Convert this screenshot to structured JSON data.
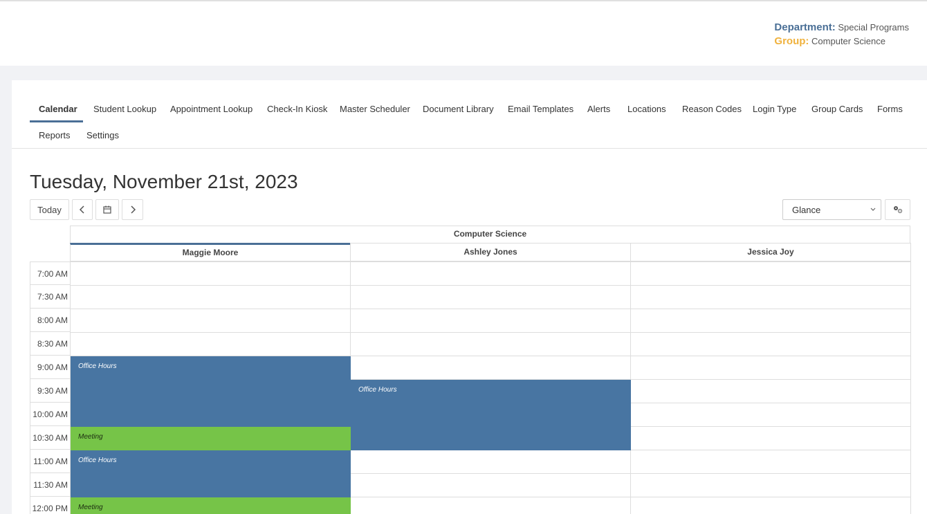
{
  "header": {
    "department_label": "Department:",
    "department_value": "Special Programs",
    "group_label": "Group:",
    "group_value": "Computer Science"
  },
  "nav": {
    "items": [
      {
        "label": "Calendar",
        "active": true
      },
      {
        "label": "Student Lookup"
      },
      {
        "label": "Appointment Lookup"
      },
      {
        "label": "Check-In Kiosk"
      },
      {
        "label": "Master Scheduler"
      },
      {
        "label": "Document Library"
      },
      {
        "label": "Email Templates"
      },
      {
        "label": "Alerts"
      },
      {
        "label": "Locations"
      },
      {
        "label": "Reason Codes"
      },
      {
        "label": "Login Type"
      },
      {
        "label": "Group Cards"
      },
      {
        "label": "Forms"
      },
      {
        "label": "Reports"
      },
      {
        "label": "Settings"
      }
    ]
  },
  "calendar": {
    "date_title": "Tuesday, November 21st, 2023",
    "today_label": "Today",
    "prev_icon": "chevron-left-icon",
    "calendar_icon": "calendar-icon",
    "next_icon": "chevron-right-icon",
    "view_select": "Glance",
    "settings_icon": "gears-icon",
    "group_name": "Computer Science",
    "staff": [
      "Maggie Moore",
      "Ashley Jones",
      "Jessica Joy"
    ],
    "times": [
      "7:00 AM",
      "7:30 AM",
      "8:00 AM",
      "8:30 AM",
      "9:00 AM",
      "9:30 AM",
      "10:00 AM",
      "10:30 AM",
      "11:00 AM",
      "11:30 AM",
      "12:00 PM"
    ],
    "events": [
      {
        "title": "Office Hours",
        "staff": 0,
        "start": "9:00 AM",
        "end": "10:30 AM",
        "type": "blue"
      },
      {
        "title": "Meeting",
        "staff": 0,
        "start": "10:30 AM",
        "end": "11:00 AM",
        "type": "green"
      },
      {
        "title": "Office Hours",
        "staff": 0,
        "start": "11:00 AM",
        "end": "12:00 PM",
        "type": "blue"
      },
      {
        "title": "Meeting",
        "staff": 0,
        "start": "12:00 PM",
        "end": "12:30 PM",
        "type": "green"
      },
      {
        "title": "Office Hours",
        "staff": 1,
        "start": "9:30 AM",
        "end": "11:00 AM",
        "type": "blue"
      }
    ],
    "colors": {
      "office_hours": "#4875a2",
      "meeting": "#76c448",
      "accent": "#4a6f96",
      "group_accent": "#f0b23e"
    }
  }
}
